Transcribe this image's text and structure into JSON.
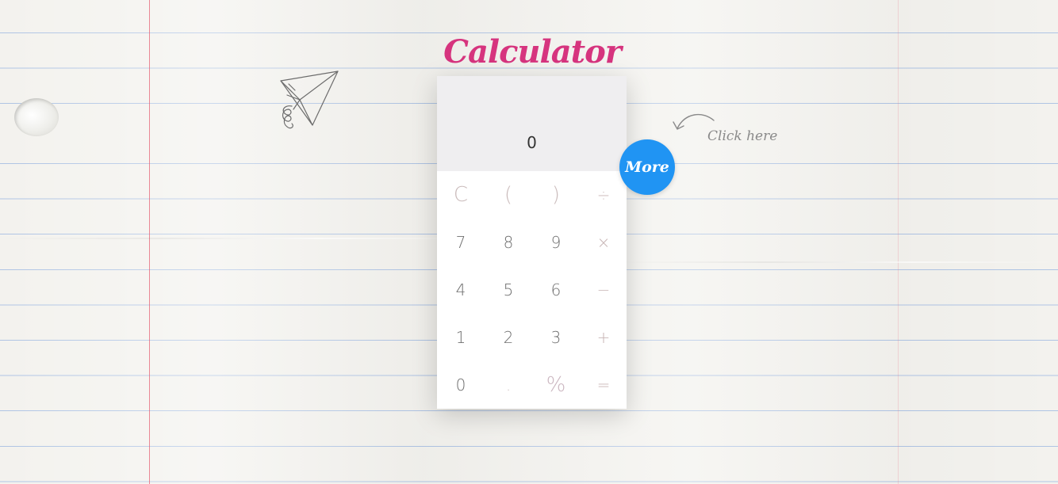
{
  "title": "Calculator",
  "display": {
    "value": "0"
  },
  "keys": [
    [
      "C",
      "(",
      ")",
      "÷"
    ],
    [
      "7",
      "8",
      "9",
      "×"
    ],
    [
      "4",
      "5",
      "6",
      "−"
    ],
    [
      "1",
      "2",
      "3",
      "+"
    ],
    [
      "0",
      ".",
      "%",
      "="
    ]
  ],
  "more_button": {
    "label": "More",
    "color": "#2094f3"
  },
  "hint": {
    "text": "Click here"
  },
  "colors": {
    "title": "#d6347e",
    "display_bg": "#efeef0"
  }
}
